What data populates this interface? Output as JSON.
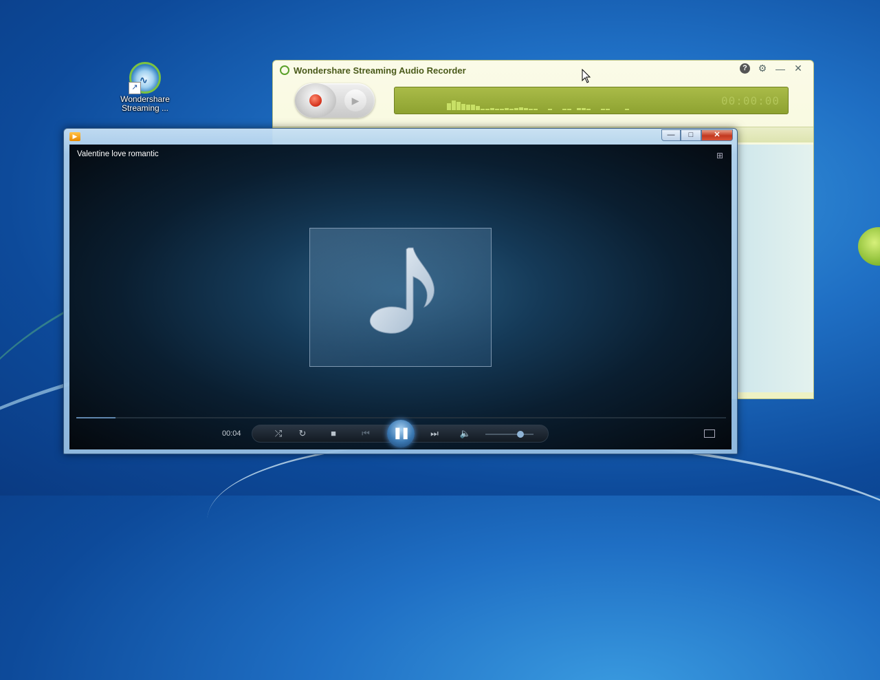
{
  "desktop": {
    "icon_label_line1": "Wondershare",
    "icon_label_line2": "Streaming ..."
  },
  "recorder": {
    "title": "Wondershare Streaming Audio Recorder",
    "time": "00:00:00",
    "record_icon": "record-icon",
    "play_icon": "play-icon",
    "help_icon": "help-icon",
    "settings_icon": "gear-icon",
    "accent": "#8ea231"
  },
  "player": {
    "title": "Valentine love romantic",
    "elapsed": "00:04",
    "progress_fraction": 0.06,
    "volume_fraction": 0.7,
    "art_icon": "music-note-icon",
    "accent": "#3b79b3"
  }
}
